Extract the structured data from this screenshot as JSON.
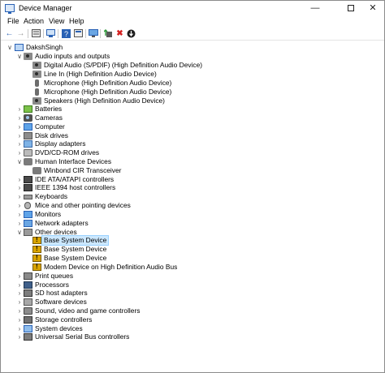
{
  "window": {
    "title": "Device Manager",
    "controls": {
      "minimize": "—",
      "maximize": "",
      "close": "✕"
    }
  },
  "menu": {
    "items": [
      "File",
      "Action",
      "View",
      "Help"
    ]
  },
  "toolbar": {
    "icons": [
      "back-arrow-icon",
      "forward-arrow-icon",
      "properties-icon",
      "computer-icon",
      "help-icon",
      "action-icon",
      "monitor-icon",
      "update-driver-icon",
      "uninstall-icon",
      "scan-icon"
    ]
  },
  "tree": {
    "root": "DakshSingh",
    "audio_inputs": {
      "label": "Audio inputs and outputs",
      "children": [
        "Digital Audio (S/PDIF) (High Definition Audio Device)",
        "Line In (High Definition Audio Device)",
        "Microphone (High Definition Audio Device)",
        "Microphone (High Definition Audio Device)",
        "Speakers (High Definition Audio Device)"
      ]
    },
    "categories_a": [
      "Batteries",
      "Cameras",
      "Computer",
      "Disk drives",
      "Display adapters",
      "DVD/CD-ROM drives"
    ],
    "hid": {
      "label": "Human Interface Devices",
      "children": [
        "Winbond CIR Transceiver"
      ]
    },
    "categories_b": [
      "IDE ATA/ATAPI controllers",
      "IEEE 1394 host controllers",
      "Keyboards",
      "Mice and other pointing devices",
      "Monitors",
      "Network adapters"
    ],
    "other_devices": {
      "label": "Other devices",
      "children": [
        "Base System Device",
        "Base System Device",
        "Base System Device",
        "Modem Device on High Definition Audio Bus"
      ]
    },
    "categories_c": [
      "Print queues",
      "Processors",
      "SD host adapters",
      "Software devices",
      "Sound, video and game controllers",
      "Storage controllers",
      "System devices",
      "Universal Serial Bus controllers"
    ]
  }
}
